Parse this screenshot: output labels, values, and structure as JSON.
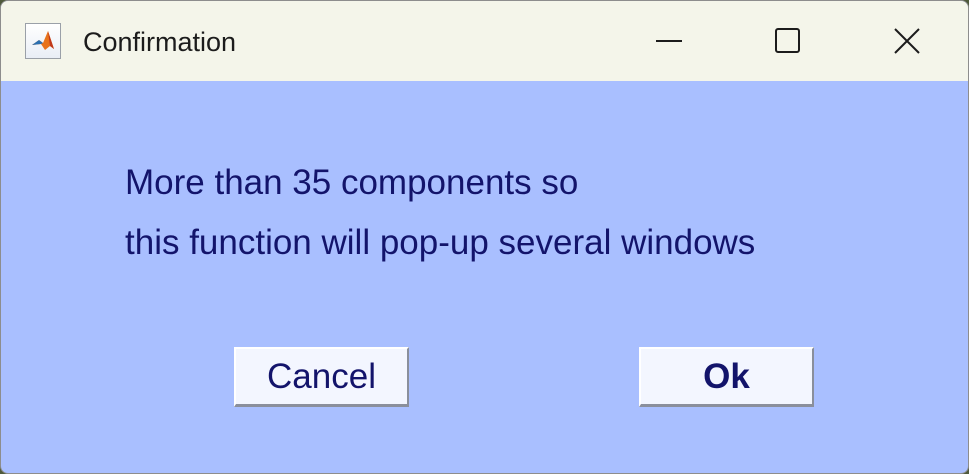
{
  "window": {
    "title": "Confirmation",
    "controls": {
      "minimize_icon": "minimize-icon",
      "maximize_icon": "maximize-icon",
      "close_icon": "close-icon"
    },
    "app_icon": "matlab-icon"
  },
  "dialog": {
    "message_line1": "More than 35 components so",
    "message_line2": "this function will pop-up several windows",
    "cancel_label": "Cancel",
    "ok_label": "Ok"
  },
  "colors": {
    "titlebar_bg": "#f4f5ea",
    "dialog_bg": "#a9bfff",
    "text": "#13146b",
    "button_bg": "#f3f6ff"
  }
}
